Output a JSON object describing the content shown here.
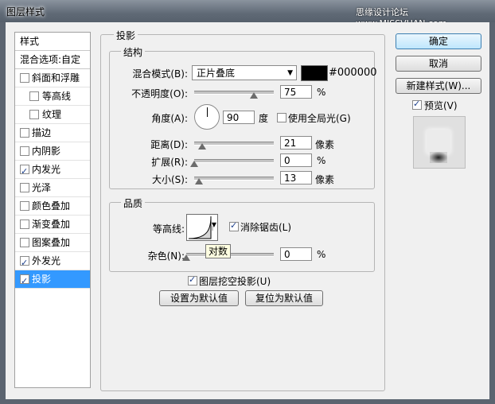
{
  "window": {
    "title": "图层样式",
    "watermark": "思缘设计论坛 www.MISSVUAN.com"
  },
  "styles_list": {
    "header": "样式",
    "blending": "混合选项:自定",
    "items": [
      {
        "label": "斜面和浮雕",
        "checked": false,
        "sub": false,
        "selected": false
      },
      {
        "label": "等高线",
        "checked": false,
        "sub": true,
        "selected": false
      },
      {
        "label": "纹理",
        "checked": false,
        "sub": true,
        "selected": false
      },
      {
        "label": "描边",
        "checked": false,
        "sub": false,
        "selected": false
      },
      {
        "label": "内阴影",
        "checked": false,
        "sub": false,
        "selected": false
      },
      {
        "label": "内发光",
        "checked": true,
        "sub": false,
        "selected": false
      },
      {
        "label": "光泽",
        "checked": false,
        "sub": false,
        "selected": false
      },
      {
        "label": "颜色叠加",
        "checked": false,
        "sub": false,
        "selected": false
      },
      {
        "label": "渐变叠加",
        "checked": false,
        "sub": false,
        "selected": false
      },
      {
        "label": "图案叠加",
        "checked": false,
        "sub": false,
        "selected": false
      },
      {
        "label": "外发光",
        "checked": true,
        "sub": false,
        "selected": false
      },
      {
        "label": "投影",
        "checked": true,
        "sub": false,
        "selected": true
      }
    ]
  },
  "drop_shadow": {
    "title": "投影",
    "structure": {
      "title": "结构",
      "blend_mode_label": "混合模式(B):",
      "blend_mode": "正片叠底",
      "color_hex": "#000000",
      "color_value": "#000000",
      "opacity_label": "不透明度(O):",
      "opacity": "75",
      "opacity_pct": 75,
      "percent": "%",
      "angle_label": "角度(A):",
      "angle": "90",
      "degree": "度",
      "global_light_label": "使用全局光(G)",
      "global_light": false,
      "distance_label": "距离(D):",
      "distance": "21",
      "distance_frac": 0.1,
      "spread_label": "扩展(R):",
      "spread": "0",
      "spread_frac": 0,
      "size_label": "大小(S):",
      "size": "13",
      "size_frac": 0.06,
      "pixels": "像素"
    },
    "quality": {
      "title": "品质",
      "contour_label": "等高线:",
      "antialias_label": "消除锯齿(L)",
      "antialias": true,
      "noise_label": "杂色(N):",
      "noise": "0",
      "noise_frac": 0,
      "tooltip": "对数"
    },
    "knockout_label": "图层挖空投影(U)",
    "knockout": true,
    "make_default": "设置为默认值",
    "reset_default": "复位为默认值"
  },
  "buttons": {
    "ok": "确定",
    "cancel": "取消",
    "new_style": "新建样式(W)...",
    "preview_label": "预览(V)",
    "preview": true
  }
}
